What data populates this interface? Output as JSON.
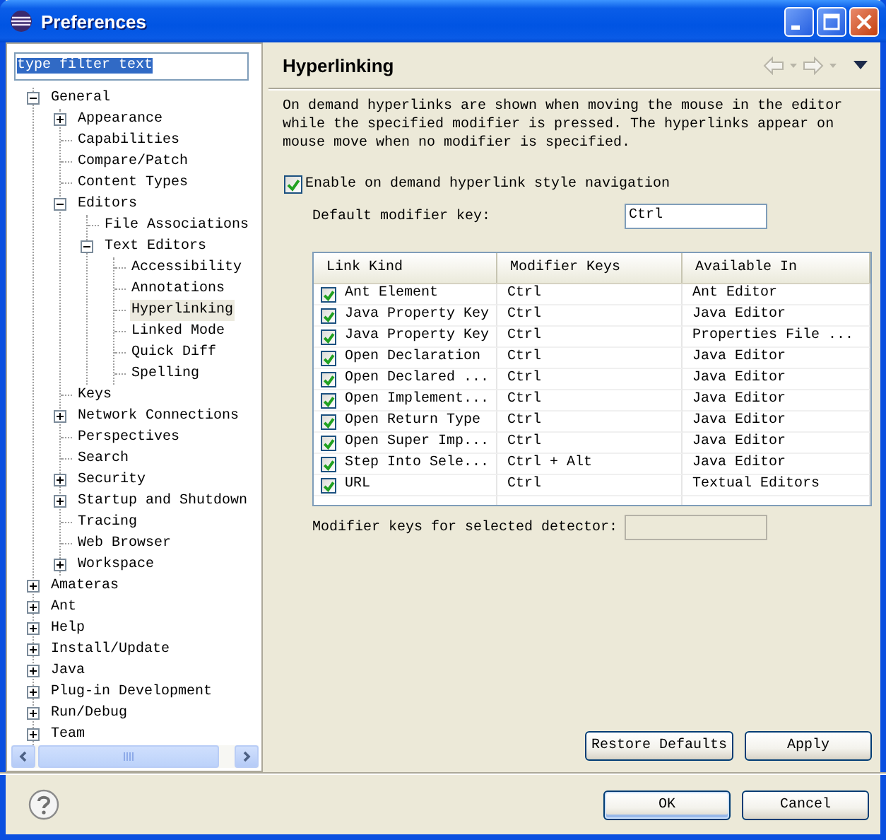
{
  "window": {
    "title": "Preferences"
  },
  "filter": {
    "value": "type filter text",
    "text_selected": true
  },
  "tree": [
    {
      "label": "General",
      "selected": false,
      "expanded": true,
      "children": [
        {
          "label": "Appearance",
          "selected": false,
          "expanded": false
        },
        {
          "label": "Capabilities",
          "selected": false
        },
        {
          "label": "Compare/Patch",
          "selected": false
        },
        {
          "label": "Content Types",
          "selected": false
        },
        {
          "label": "Editors",
          "selected": false,
          "expanded": true,
          "children": [
            {
              "label": "File Associations",
              "selected": false
            },
            {
              "label": "Text Editors",
              "selected": false,
              "expanded": true,
              "children": [
                {
                  "label": "Accessibility",
                  "selected": false
                },
                {
                  "label": "Annotations",
                  "selected": false
                },
                {
                  "label": "Hyperlinking",
                  "selected": true
                },
                {
                  "label": "Linked Mode",
                  "selected": false
                },
                {
                  "label": "Quick Diff",
                  "selected": false
                },
                {
                  "label": "Spelling",
                  "selected": false
                }
              ]
            }
          ]
        },
        {
          "label": "Keys",
          "selected": false
        },
        {
          "label": "Network Connections",
          "selected": false,
          "expanded": false
        },
        {
          "label": "Perspectives",
          "selected": false
        },
        {
          "label": "Search",
          "selected": false
        },
        {
          "label": "Security",
          "selected": false,
          "expanded": false
        },
        {
          "label": "Startup and Shutdown",
          "selected": false,
          "expanded": false
        },
        {
          "label": "Tracing",
          "selected": false
        },
        {
          "label": "Web Browser",
          "selected": false
        },
        {
          "label": "Workspace",
          "selected": false,
          "expanded": false
        }
      ]
    },
    {
      "label": "Amateras",
      "selected": false,
      "expanded": false
    },
    {
      "label": "Ant",
      "selected": false,
      "expanded": false
    },
    {
      "label": "Help",
      "selected": false,
      "expanded": false
    },
    {
      "label": "Install/Update",
      "selected": false,
      "expanded": false
    },
    {
      "label": "Java",
      "selected": false,
      "expanded": false
    },
    {
      "label": "Plug-in Development",
      "selected": false,
      "expanded": false
    },
    {
      "label": "Run/Debug",
      "selected": false,
      "expanded": false
    },
    {
      "label": "Team",
      "selected": false,
      "expanded": false
    }
  ],
  "page": {
    "title": "Hyperlinking",
    "navigation": {
      "back": {
        "disabled": true
      },
      "forward": {
        "disabled": true
      }
    },
    "description": "On demand hyperlinks are shown when moving the mouse in the editor while the specified modifier is pressed. The hyperlinks appear on mouse move when no modifier is specified.",
    "enable_option": {
      "label": "Enable on demand hyperlink style navigation",
      "checked": true
    },
    "default_modifier": {
      "label": "Default modifier key:",
      "value": "Ctrl"
    },
    "table": {
      "columns": [
        "Link Kind",
        "Modifier Keys",
        "Available In"
      ],
      "rows": [
        {
          "checked": true,
          "cells": [
            "Ant Element",
            "Ctrl",
            "Ant Editor"
          ]
        },
        {
          "checked": true,
          "cells": [
            "Java Property Key",
            "Ctrl",
            "Java Editor"
          ]
        },
        {
          "checked": true,
          "cells": [
            "Java Property Key",
            "Ctrl",
            "Properties File ..."
          ]
        },
        {
          "checked": true,
          "cells": [
            "Open Declaration",
            "Ctrl",
            "Java Editor"
          ]
        },
        {
          "checked": true,
          "cells": [
            "Open Declared ...",
            "Ctrl",
            "Java Editor"
          ]
        },
        {
          "checked": true,
          "cells": [
            "Open Implement...",
            "Ctrl",
            "Java Editor"
          ]
        },
        {
          "checked": true,
          "cells": [
            "Open Return Type",
            "Ctrl",
            "Java Editor"
          ]
        },
        {
          "checked": true,
          "cells": [
            "Open Super Imp...",
            "Ctrl",
            "Java Editor"
          ]
        },
        {
          "checked": true,
          "cells": [
            "Step Into Sele...",
            "Ctrl + Alt",
            "Java Editor"
          ]
        },
        {
          "checked": true,
          "cells": [
            "URL",
            "Ctrl",
            "Textual Editors"
          ]
        }
      ]
    },
    "selected_modifier": {
      "label": "Modifier keys for selected detector:",
      "disabled": true
    },
    "buttons": [
      {
        "label": "Restore Defaults"
      },
      {
        "label": "Apply"
      }
    ]
  },
  "dialog_buttons": [
    {
      "label": "OK",
      "default": true
    },
    {
      "label": "Cancel",
      "default": false
    }
  ]
}
